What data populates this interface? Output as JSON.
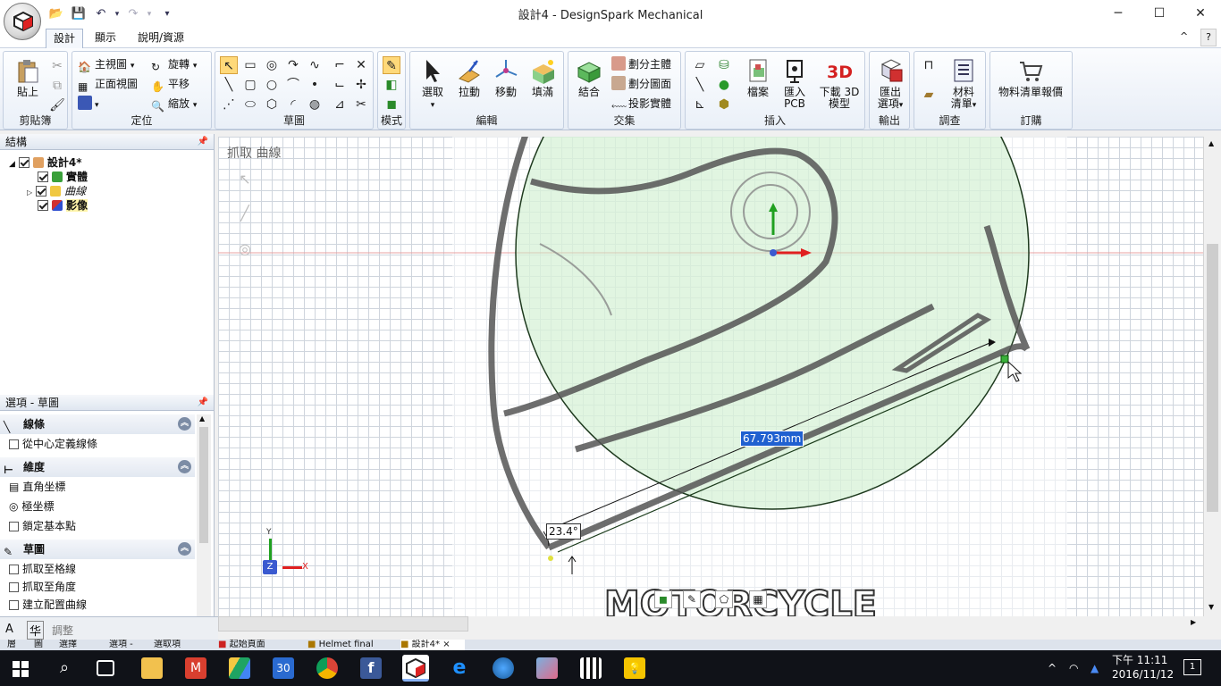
{
  "window": {
    "title": "設計4 - DesignSpark Mechanical",
    "minimize_icon": "─",
    "maximize_icon": "☐",
    "close_icon": "✕",
    "help_icon": "^",
    "help_q": "?"
  },
  "tabs": [
    {
      "label": "設計",
      "active": true
    },
    {
      "label": "顯示",
      "active": false
    },
    {
      "label": "說明/資源",
      "active": false
    }
  ],
  "ribbon": {
    "clipboard": {
      "label": "剪貼簿",
      "paste": "貼上"
    },
    "orient": {
      "label": "定位",
      "home": "主視圖",
      "plan": "正面視圖",
      "spin": "旋轉",
      "pan": "平移",
      "zoom": "縮放"
    },
    "sketch": {
      "label": "草圖"
    },
    "mode": {
      "label": "模式"
    },
    "edit": {
      "label": "編輯",
      "select": "選取",
      "pull": "拉動",
      "move": "移動",
      "fill": "填滿"
    },
    "intersect": {
      "label": "交集",
      "combine": "結合",
      "split_body": "劃分主體",
      "split_face": "劃分圖面",
      "project": "投影實體"
    },
    "insert": {
      "label": "插入",
      "file": "檔案",
      "pcb_line1": "匯入",
      "pcb_line2": "PCB",
      "download_line1": "下載 3D",
      "download_line2": "模型"
    },
    "output": {
      "label": "輸出",
      "export_line1": "匯出",
      "export_line2": "選項"
    },
    "investigate": {
      "label": "調查",
      "bom_line1": "材料",
      "bom_line2": "清單"
    },
    "order": {
      "label": "訂購",
      "quote": "物料清單報價"
    }
  },
  "structure": {
    "title": "結構",
    "items": [
      {
        "label": "設計4*",
        "bold": true
      },
      {
        "label": "實體"
      },
      {
        "label": "曲線"
      },
      {
        "label": "影像"
      }
    ]
  },
  "options": {
    "title": "選項 - 草圖",
    "sections": [
      {
        "title": "線條",
        "rows": [
          "從中心定義線條"
        ]
      },
      {
        "title": "維度",
        "rows": [
          "直角坐標",
          "極坐標",
          "鎖定基本點"
        ]
      },
      {
        "title": "草圖",
        "rows": [
          "抓取至格線",
          "抓取至角度",
          "建立配置曲線"
        ]
      }
    ]
  },
  "canvas": {
    "hint": "抓取 曲線",
    "dimension_length": "67.793mm",
    "dimension_angle": "23.4°",
    "watermark": "MOTORCYCLE",
    "triad": {
      "y": "Y",
      "x": "X",
      "z": "Z"
    },
    "bottom_status": "調整"
  },
  "doc_tabs": [
    "起始頁面",
    "Helmet final",
    "設計4*"
  ],
  "left_tabs": [
    "層",
    "圖",
    "選擇",
    "選項 -",
    "選取項"
  ],
  "taskbar": {
    "time": "下午 11:11",
    "date": "2016/11/12",
    "notifications": "1",
    "calendar_day": "30"
  }
}
